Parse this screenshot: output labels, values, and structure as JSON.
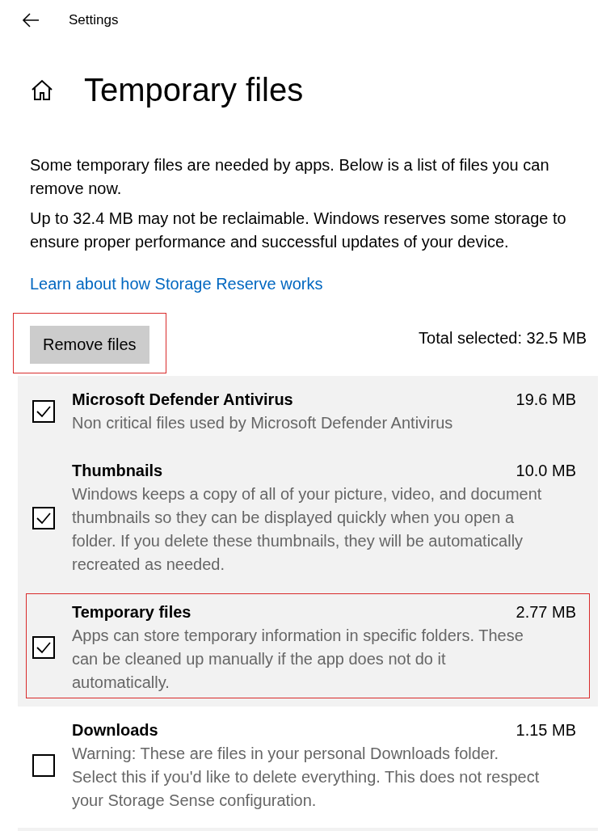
{
  "header": {
    "title": "Settings"
  },
  "page_title": "Temporary files",
  "paragraphs": [
    "Some temporary files are needed by apps. Below is a list of files you can remove now.",
    "Up to 32.4 MB may not be reclaimable. Windows reserves some storage to ensure proper performance and successful updates of your device."
  ],
  "link": "Learn about how Storage Reserve works",
  "remove_button": {
    "label": "Remove files",
    "highlighted": true
  },
  "total_selected": "Total selected: 32.5 MB",
  "items": [
    {
      "name": "Microsoft Defender Antivirus",
      "size": "19.6 MB",
      "description": "Non critical files used by Microsoft Defender Antivirus",
      "checked": true,
      "highlighted": false
    },
    {
      "name": "Thumbnails",
      "size": "10.0 MB",
      "description": "Windows keeps a copy of all of your picture, video, and document thumbnails so they can be displayed quickly when you open a folder. If you delete these thumbnails, they will be automatically recreated as needed.",
      "checked": true,
      "highlighted": false
    },
    {
      "name": "Temporary files",
      "size": "2.77 MB",
      "description": "Apps can store temporary information in specific folders. These can be cleaned up manually if the app does not do it automatically.",
      "checked": true,
      "highlighted": true
    },
    {
      "name": "Downloads",
      "size": "1.15 MB",
      "description": "Warning: These are files in your personal Downloads folder. Select this if you'd like to delete everything. This does not respect your Storage Sense configuration.",
      "checked": false,
      "highlighted": false
    }
  ]
}
